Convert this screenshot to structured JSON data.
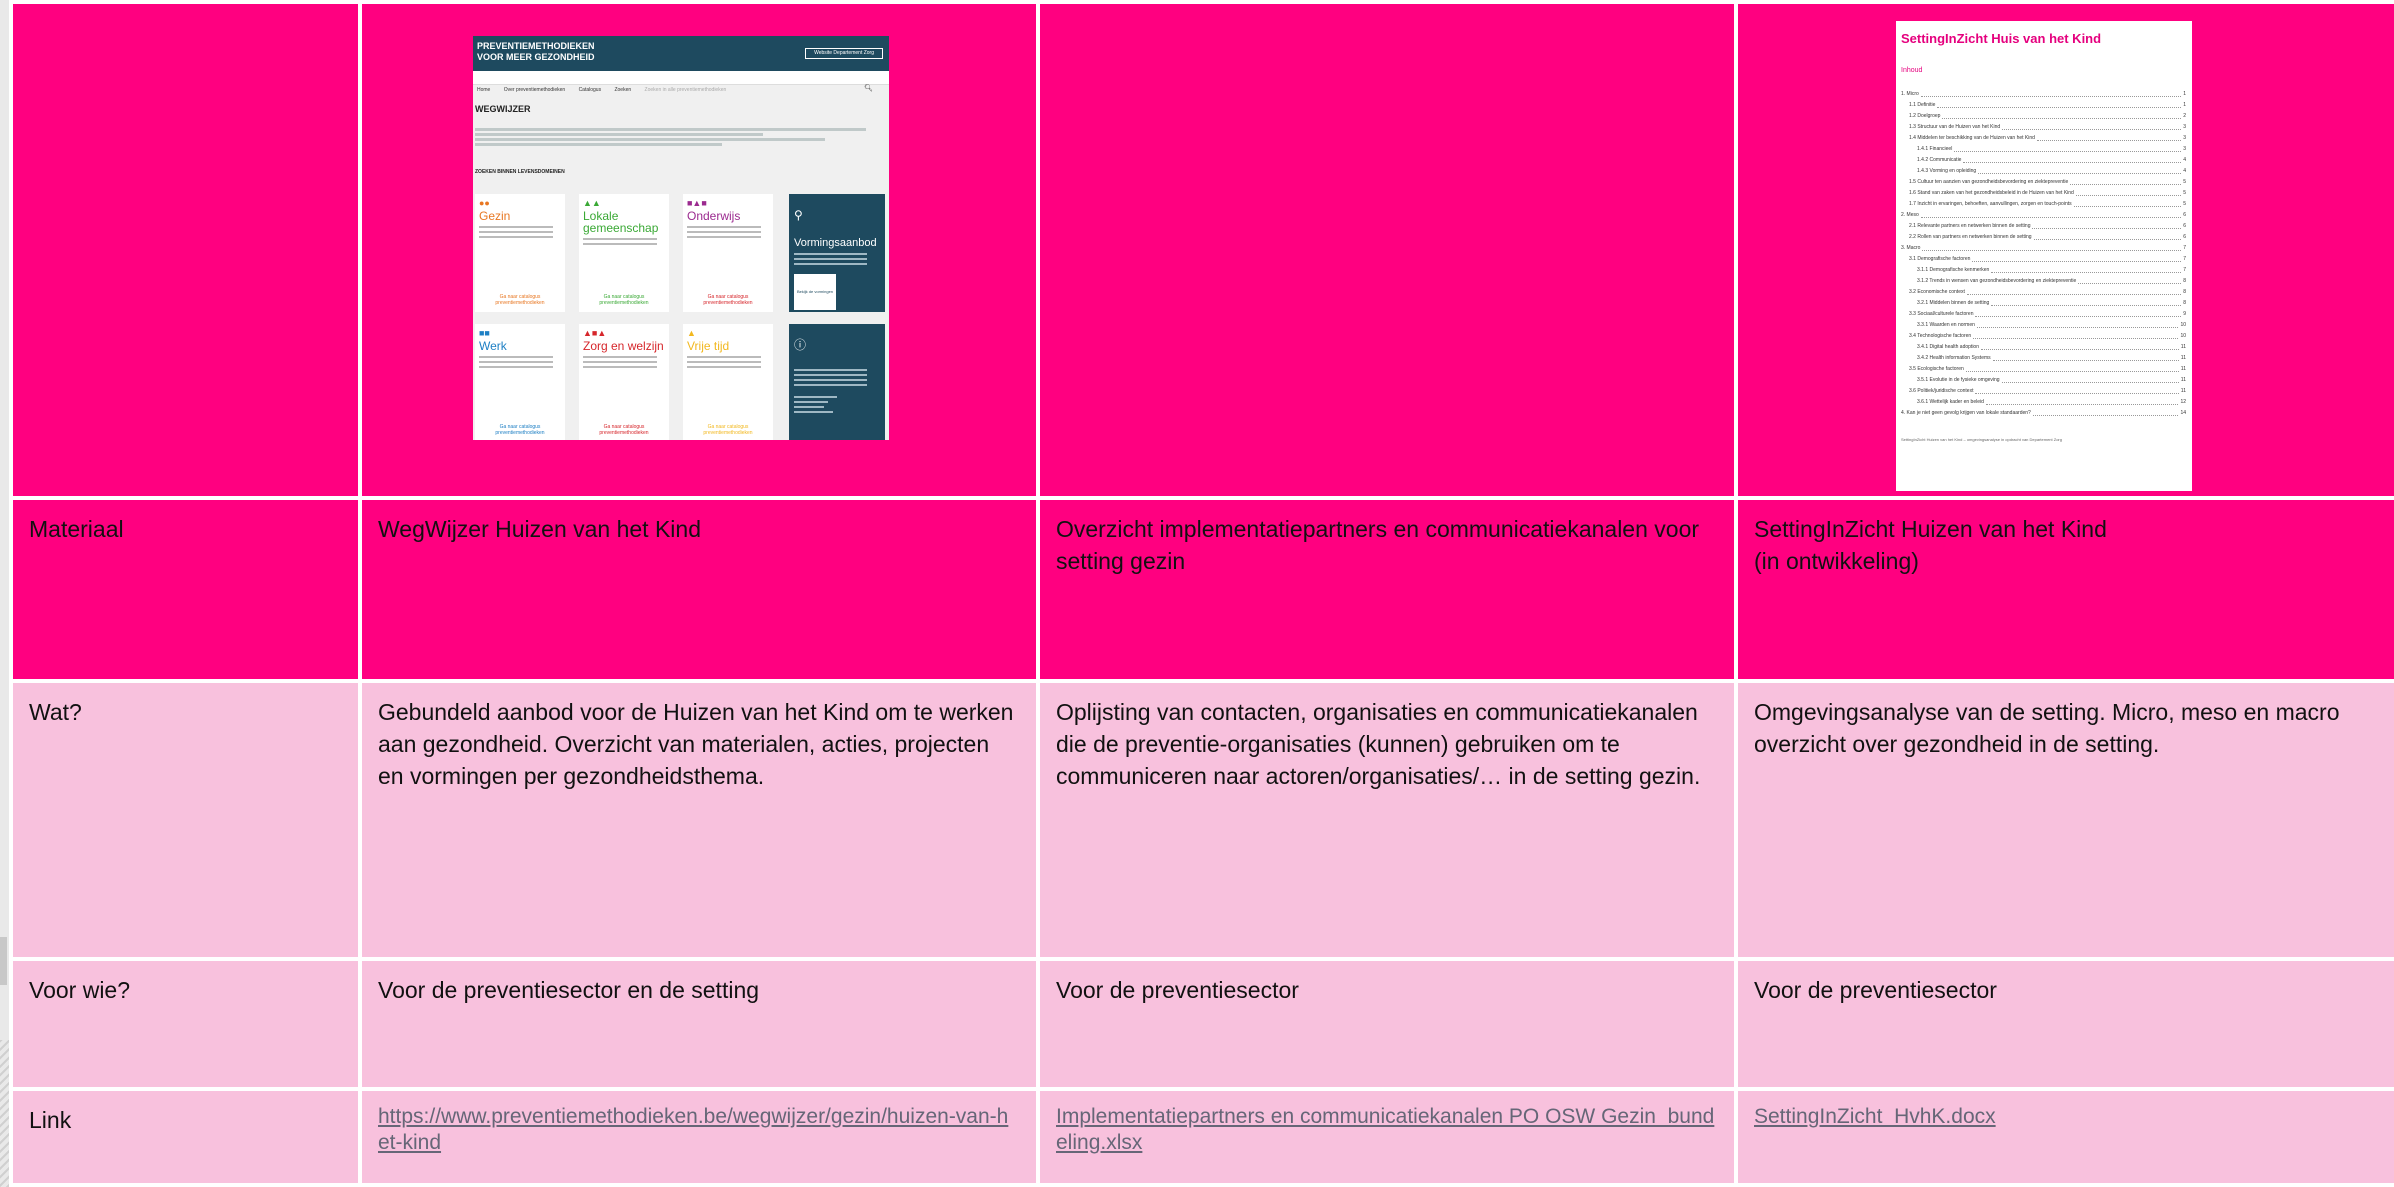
{
  "thumbnail_site": {
    "header_title": "PREVENTIEMETHODIEKEN\nVOOR MEER GEZONDHEID",
    "header_button": "Website Departement Zorg",
    "nav": [
      "Home",
      "Over preventiemethodieken",
      "Catalogus",
      "Zoeken",
      "Zoeken in alle preventiemethodieken"
    ],
    "page_title": "WEGWIJZER",
    "section_title": "ZOEKEN BINNEN LEVENSDOMEINEN",
    "cards": [
      {
        "title": "Gezin",
        "color": "#e87722",
        "cta": "Ga naar catalogus\npreventiemethodieken"
      },
      {
        "title": "Lokale\ngemeenschap",
        "color": "#3aa935",
        "cta": "Ga naar catalogus\npreventiemethodieken"
      },
      {
        "title": "Onderwijs",
        "color": "#9b2a8f",
        "cta": "Ga naar catalogus\npreventiemethodieken"
      },
      {
        "title": "Werk",
        "color": "#1d7fc4",
        "cta": "Ga naar catalogus\npreventiemethodieken"
      },
      {
        "title": "Zorg en welzijn",
        "color": "#d6262b",
        "cta": "Ga naar catalogus\npreventiemethodieken"
      },
      {
        "title": "Vrije tijd",
        "color": "#f2b81f",
        "cta": "Ga naar catalogus\npreventiemethodieken"
      }
    ],
    "vorming": {
      "title": "Vormingsaanbod",
      "button": "Bekijk de vormingen"
    }
  },
  "thumbnail_doc": {
    "title": "SettingInZicht Huis van het Kind",
    "toc_heading": "Inhoud",
    "toc": [
      {
        "n": "1.",
        "t": "Micro",
        "p": "1",
        "lvl": 1
      },
      {
        "n": "1.1",
        "t": "Definitie",
        "p": "1",
        "lvl": 2
      },
      {
        "n": "1.2",
        "t": "Doelgroep",
        "p": "2",
        "lvl": 2
      },
      {
        "n": "1.3",
        "t": "Structuur van de Huizen van het Kind",
        "p": "3",
        "lvl": 2
      },
      {
        "n": "1.4",
        "t": "Middelen ter beschikking van de Huizen van het Kind",
        "p": "3",
        "lvl": 2
      },
      {
        "n": "1.4.1",
        "t": "Financieel",
        "p": "3",
        "lvl": 3
      },
      {
        "n": "1.4.2",
        "t": "Communicatie",
        "p": "4",
        "lvl": 3
      },
      {
        "n": "1.4.3",
        "t": "Vorming en opleiding",
        "p": "4",
        "lvl": 3
      },
      {
        "n": "1.5",
        "t": "Cultuur ten aanzien van gezondheidsbevordering en ziektepreventie",
        "p": "5",
        "lvl": 2
      },
      {
        "n": "1.6",
        "t": "Stand van zaken van het gezondheidsbeleid in de Huizen van het Kind",
        "p": "5",
        "lvl": 2
      },
      {
        "n": "1.7",
        "t": "Inzicht in ervaringen, behoeften, aanvullingen, zorgen en touch-points",
        "p": "5",
        "lvl": 2
      },
      {
        "n": "2.",
        "t": "Meso",
        "p": "6",
        "lvl": 1
      },
      {
        "n": "2.1",
        "t": "Relevante partners en netwerken binnen de setting",
        "p": "6",
        "lvl": 2
      },
      {
        "n": "2.2",
        "t": "Rollen van partners en netwerken binnen de setting",
        "p": "6",
        "lvl": 2
      },
      {
        "n": "3.",
        "t": "Macro",
        "p": "7",
        "lvl": 1
      },
      {
        "n": "3.1",
        "t": "Demografische factoren",
        "p": "7",
        "lvl": 2
      },
      {
        "n": "3.1.1",
        "t": "Demografische kenmerken",
        "p": "7",
        "lvl": 3
      },
      {
        "n": "3.1.2",
        "t": "Trends in wensen van gezondheidsbevordering en ziektepreventie",
        "p": "8",
        "lvl": 3
      },
      {
        "n": "3.2",
        "t": "Economische context",
        "p": "8",
        "lvl": 2
      },
      {
        "n": "3.2.1",
        "t": "Middelen binnen de setting",
        "p": "8",
        "lvl": 3
      },
      {
        "n": "3.3",
        "t": "Sociaal/culturele factoren",
        "p": "9",
        "lvl": 2
      },
      {
        "n": "3.3.1",
        "t": "Waarden en normen",
        "p": "10",
        "lvl": 3
      },
      {
        "n": "3.4",
        "t": "Technologische factoren",
        "p": "10",
        "lvl": 2
      },
      {
        "n": "3.4.1",
        "t": "Digital health adoption",
        "p": "11",
        "lvl": 3
      },
      {
        "n": "3.4.2",
        "t": "Health information Systems",
        "p": "11",
        "lvl": 3
      },
      {
        "n": "3.5",
        "t": "Ecologische factoren",
        "p": "11",
        "lvl": 2
      },
      {
        "n": "3.5.1",
        "t": "Evolutie in de fysieke omgeving",
        "p": "11",
        "lvl": 3
      },
      {
        "n": "3.6",
        "t": "Politiek/juridische context",
        "p": "11",
        "lvl": 2
      },
      {
        "n": "3.6.1",
        "t": "Wettelijk kader en beleid",
        "p": "12",
        "lvl": 3
      },
      {
        "n": "4.",
        "t": "Kan je niet geen gevolg krijgen van lokale standaarden?",
        "p": "14",
        "lvl": 1
      }
    ],
    "footer": "SettingInZicht Huizen van het Kind – omgevingsanalyse in opdracht van Departement Zorg"
  },
  "rows": {
    "materiaal": {
      "label": "Materiaal",
      "col1": "WegWijzer Huizen van het Kind",
      "col2": "Overzicht implementatiepartners en communicatiekanalen voor setting gezin",
      "col3": "SettingInZicht Huizen van het Kind\n(in ontwikkeling)"
    },
    "wat": {
      "label": "Wat?",
      "col1": "Gebundeld aanbod voor de Huizen van het Kind om te werken aan gezondheid. Overzicht van materialen, acties, projecten en vormingen per gezondheidsthema.",
      "col2": "Oplijsting van contacten, organisaties en communicatiekanalen die de preventie-organisaties (kunnen) gebruiken om te communiceren naar actoren/organisaties/… in de setting gezin.",
      "col3": "Omgevingsanalyse van de setting. Micro, meso en macro overzicht over gezondheid in de setting."
    },
    "voor_wie": {
      "label": "Voor wie?",
      "col1": "Voor de preventiesector en de setting",
      "col2": "Voor de preventiesector",
      "col3": "Voor de preventiesector"
    },
    "link": {
      "label": "Link",
      "col1": "https://www.preventiemethodieken.be/wegwijzer/gezin/huizen-van-het-kind",
      "col2": "Implementatiepartners en communicatiekanalen PO OSW Gezin_bundeling.xlsx",
      "col3": "SettingInZicht_HvhK.docx"
    }
  },
  "colors": {
    "magenta": "#ff0080",
    "light_pink": "#f8c1dd",
    "site_dark": "#1e4a5f",
    "doc_accent": "#e5007e"
  }
}
